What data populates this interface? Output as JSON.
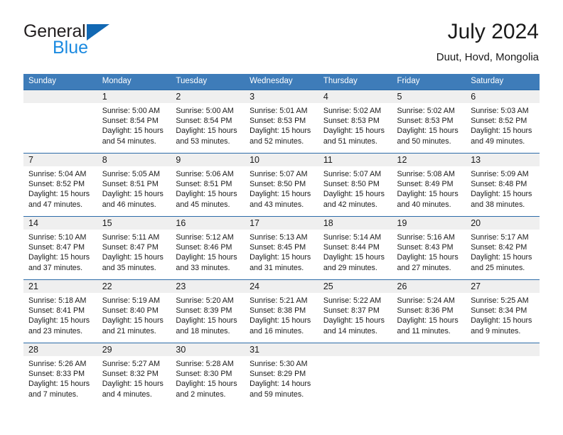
{
  "brand": {
    "name_part1": "General",
    "name_part2": "Blue",
    "triangle_color": "#1268b3",
    "blue_color": "#1b8ae0"
  },
  "header": {
    "title": "July 2024",
    "subtitle": "Duut, Hovd, Mongolia"
  },
  "theme": {
    "header_background": "#3e7cb9",
    "header_text": "#ffffff",
    "row_divider": "#2d6ca8",
    "daynum_band": "#efefef",
    "cell_background": "#ffffff",
    "text": "#1a1a1a"
  },
  "weekday_headers": [
    "Sunday",
    "Monday",
    "Tuesday",
    "Wednesday",
    "Thursday",
    "Friday",
    "Saturday"
  ],
  "weeks": [
    [
      {
        "day": "",
        "sunrise": "",
        "sunset": "",
        "daylight_line1": "",
        "daylight_line2": "",
        "empty": true
      },
      {
        "day": "1",
        "sunrise": "Sunrise: 5:00 AM",
        "sunset": "Sunset: 8:54 PM",
        "daylight_line1": "Daylight: 15 hours",
        "daylight_line2": "and 54 minutes.",
        "empty": false
      },
      {
        "day": "2",
        "sunrise": "Sunrise: 5:00 AM",
        "sunset": "Sunset: 8:54 PM",
        "daylight_line1": "Daylight: 15 hours",
        "daylight_line2": "and 53 minutes.",
        "empty": false
      },
      {
        "day": "3",
        "sunrise": "Sunrise: 5:01 AM",
        "sunset": "Sunset: 8:53 PM",
        "daylight_line1": "Daylight: 15 hours",
        "daylight_line2": "and 52 minutes.",
        "empty": false
      },
      {
        "day": "4",
        "sunrise": "Sunrise: 5:02 AM",
        "sunset": "Sunset: 8:53 PM",
        "daylight_line1": "Daylight: 15 hours",
        "daylight_line2": "and 51 minutes.",
        "empty": false
      },
      {
        "day": "5",
        "sunrise": "Sunrise: 5:02 AM",
        "sunset": "Sunset: 8:53 PM",
        "daylight_line1": "Daylight: 15 hours",
        "daylight_line2": "and 50 minutes.",
        "empty": false
      },
      {
        "day": "6",
        "sunrise": "Sunrise: 5:03 AM",
        "sunset": "Sunset: 8:52 PM",
        "daylight_line1": "Daylight: 15 hours",
        "daylight_line2": "and 49 minutes.",
        "empty": false
      }
    ],
    [
      {
        "day": "7",
        "sunrise": "Sunrise: 5:04 AM",
        "sunset": "Sunset: 8:52 PM",
        "daylight_line1": "Daylight: 15 hours",
        "daylight_line2": "and 47 minutes.",
        "empty": false
      },
      {
        "day": "8",
        "sunrise": "Sunrise: 5:05 AM",
        "sunset": "Sunset: 8:51 PM",
        "daylight_line1": "Daylight: 15 hours",
        "daylight_line2": "and 46 minutes.",
        "empty": false
      },
      {
        "day": "9",
        "sunrise": "Sunrise: 5:06 AM",
        "sunset": "Sunset: 8:51 PM",
        "daylight_line1": "Daylight: 15 hours",
        "daylight_line2": "and 45 minutes.",
        "empty": false
      },
      {
        "day": "10",
        "sunrise": "Sunrise: 5:07 AM",
        "sunset": "Sunset: 8:50 PM",
        "daylight_line1": "Daylight: 15 hours",
        "daylight_line2": "and 43 minutes.",
        "empty": false
      },
      {
        "day": "11",
        "sunrise": "Sunrise: 5:07 AM",
        "sunset": "Sunset: 8:50 PM",
        "daylight_line1": "Daylight: 15 hours",
        "daylight_line2": "and 42 minutes.",
        "empty": false
      },
      {
        "day": "12",
        "sunrise": "Sunrise: 5:08 AM",
        "sunset": "Sunset: 8:49 PM",
        "daylight_line1": "Daylight: 15 hours",
        "daylight_line2": "and 40 minutes.",
        "empty": false
      },
      {
        "day": "13",
        "sunrise": "Sunrise: 5:09 AM",
        "sunset": "Sunset: 8:48 PM",
        "daylight_line1": "Daylight: 15 hours",
        "daylight_line2": "and 38 minutes.",
        "empty": false
      }
    ],
    [
      {
        "day": "14",
        "sunrise": "Sunrise: 5:10 AM",
        "sunset": "Sunset: 8:47 PM",
        "daylight_line1": "Daylight: 15 hours",
        "daylight_line2": "and 37 minutes.",
        "empty": false
      },
      {
        "day": "15",
        "sunrise": "Sunrise: 5:11 AM",
        "sunset": "Sunset: 8:47 PM",
        "daylight_line1": "Daylight: 15 hours",
        "daylight_line2": "and 35 minutes.",
        "empty": false
      },
      {
        "day": "16",
        "sunrise": "Sunrise: 5:12 AM",
        "sunset": "Sunset: 8:46 PM",
        "daylight_line1": "Daylight: 15 hours",
        "daylight_line2": "and 33 minutes.",
        "empty": false
      },
      {
        "day": "17",
        "sunrise": "Sunrise: 5:13 AM",
        "sunset": "Sunset: 8:45 PM",
        "daylight_line1": "Daylight: 15 hours",
        "daylight_line2": "and 31 minutes.",
        "empty": false
      },
      {
        "day": "18",
        "sunrise": "Sunrise: 5:14 AM",
        "sunset": "Sunset: 8:44 PM",
        "daylight_line1": "Daylight: 15 hours",
        "daylight_line2": "and 29 minutes.",
        "empty": false
      },
      {
        "day": "19",
        "sunrise": "Sunrise: 5:16 AM",
        "sunset": "Sunset: 8:43 PM",
        "daylight_line1": "Daylight: 15 hours",
        "daylight_line2": "and 27 minutes.",
        "empty": false
      },
      {
        "day": "20",
        "sunrise": "Sunrise: 5:17 AM",
        "sunset": "Sunset: 8:42 PM",
        "daylight_line1": "Daylight: 15 hours",
        "daylight_line2": "and 25 minutes.",
        "empty": false
      }
    ],
    [
      {
        "day": "21",
        "sunrise": "Sunrise: 5:18 AM",
        "sunset": "Sunset: 8:41 PM",
        "daylight_line1": "Daylight: 15 hours",
        "daylight_line2": "and 23 minutes.",
        "empty": false
      },
      {
        "day": "22",
        "sunrise": "Sunrise: 5:19 AM",
        "sunset": "Sunset: 8:40 PM",
        "daylight_line1": "Daylight: 15 hours",
        "daylight_line2": "and 21 minutes.",
        "empty": false
      },
      {
        "day": "23",
        "sunrise": "Sunrise: 5:20 AM",
        "sunset": "Sunset: 8:39 PM",
        "daylight_line1": "Daylight: 15 hours",
        "daylight_line2": "and 18 minutes.",
        "empty": false
      },
      {
        "day": "24",
        "sunrise": "Sunrise: 5:21 AM",
        "sunset": "Sunset: 8:38 PM",
        "daylight_line1": "Daylight: 15 hours",
        "daylight_line2": "and 16 minutes.",
        "empty": false
      },
      {
        "day": "25",
        "sunrise": "Sunrise: 5:22 AM",
        "sunset": "Sunset: 8:37 PM",
        "daylight_line1": "Daylight: 15 hours",
        "daylight_line2": "and 14 minutes.",
        "empty": false
      },
      {
        "day": "26",
        "sunrise": "Sunrise: 5:24 AM",
        "sunset": "Sunset: 8:36 PM",
        "daylight_line1": "Daylight: 15 hours",
        "daylight_line2": "and 11 minutes.",
        "empty": false
      },
      {
        "day": "27",
        "sunrise": "Sunrise: 5:25 AM",
        "sunset": "Sunset: 8:34 PM",
        "daylight_line1": "Daylight: 15 hours",
        "daylight_line2": "and 9 minutes.",
        "empty": false
      }
    ],
    [
      {
        "day": "28",
        "sunrise": "Sunrise: 5:26 AM",
        "sunset": "Sunset: 8:33 PM",
        "daylight_line1": "Daylight: 15 hours",
        "daylight_line2": "and 7 minutes.",
        "empty": false
      },
      {
        "day": "29",
        "sunrise": "Sunrise: 5:27 AM",
        "sunset": "Sunset: 8:32 PM",
        "daylight_line1": "Daylight: 15 hours",
        "daylight_line2": "and 4 minutes.",
        "empty": false
      },
      {
        "day": "30",
        "sunrise": "Sunrise: 5:28 AM",
        "sunset": "Sunset: 8:30 PM",
        "daylight_line1": "Daylight: 15 hours",
        "daylight_line2": "and 2 minutes.",
        "empty": false
      },
      {
        "day": "31",
        "sunrise": "Sunrise: 5:30 AM",
        "sunset": "Sunset: 8:29 PM",
        "daylight_line1": "Daylight: 14 hours",
        "daylight_line2": "and 59 minutes.",
        "empty": false
      },
      {
        "day": "",
        "sunrise": "",
        "sunset": "",
        "daylight_line1": "",
        "daylight_line2": "",
        "empty": true
      },
      {
        "day": "",
        "sunrise": "",
        "sunset": "",
        "daylight_line1": "",
        "daylight_line2": "",
        "empty": true
      },
      {
        "day": "",
        "sunrise": "",
        "sunset": "",
        "daylight_line1": "",
        "daylight_line2": "",
        "empty": true
      }
    ]
  ]
}
